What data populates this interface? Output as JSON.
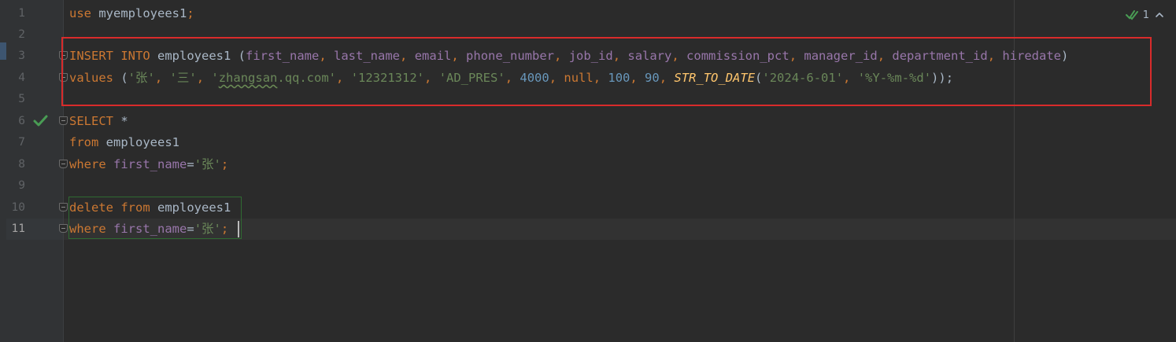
{
  "editor": {
    "inspection": {
      "count": "1"
    },
    "line_numbers": [
      "1",
      "2",
      "3",
      "4",
      "5",
      "6",
      "7",
      "8",
      "9",
      "10",
      "11"
    ],
    "lines": {
      "l1": {
        "kw_use": "use",
        "db": "myemployees1",
        "semi": ";"
      },
      "l3": {
        "kw_insert": "INSERT",
        "kw_into": "INTO",
        "table": "employees1",
        "open": " (",
        "c1": "first_name",
        "c2": "last_name",
        "c3": "email",
        "c4": "phone_number",
        "c5": "job_id",
        "c6": "salary",
        "c7": "commission_pct",
        "c8": "manager_id",
        "c9": "department_id",
        "c10": "hiredate",
        "comma": ", ",
        "close": ")"
      },
      "l4": {
        "kw_values": "values",
        "open": " (",
        "s1": "'张'",
        "s2": "'三'",
        "s3_q": "'",
        "s3_typo": "zhangsan",
        "s3_rest": ".qq.com'",
        "s4": "'12321312'",
        "s5": "'AD_PRES'",
        "n1": "4000",
        "kw_null": "null",
        "n2": "100",
        "n3": "90",
        "fn": "STR_TO_DATE",
        "fn_open": "(",
        "s6": "'2024-6-01'",
        "s7": "'%Y-%m-%d'",
        "close": "));",
        "comma": ", "
      },
      "l6": {
        "kw_select": "SELECT",
        "star": " *"
      },
      "l7": {
        "kw_from": "from",
        "table": " employees1"
      },
      "l8": {
        "kw_where": "where",
        "col": "first_name",
        "eq": "=",
        "str": "'张'",
        "semi": ";"
      },
      "l10": {
        "kw_delete": "delete",
        "kw_from": "from",
        "table": " employees1"
      },
      "l11": {
        "kw_where": "where",
        "col": "first_name",
        "eq": "=",
        "str": "'张'",
        "semi": ";"
      }
    }
  },
  "colors": {
    "background": "#2b2b2b",
    "keyword": "#cc7832",
    "column": "#9876aa",
    "string": "#6a8759",
    "number": "#6897bb",
    "function": "#ffc66d",
    "highlight_border": "#d92b2b",
    "run_check": "#499c54"
  },
  "icons": {
    "run_gutter": "checkmark-icon",
    "inspection": "double-check-icon",
    "collapse": "chevron-up-icon",
    "fold": "fold-marker-icon"
  }
}
